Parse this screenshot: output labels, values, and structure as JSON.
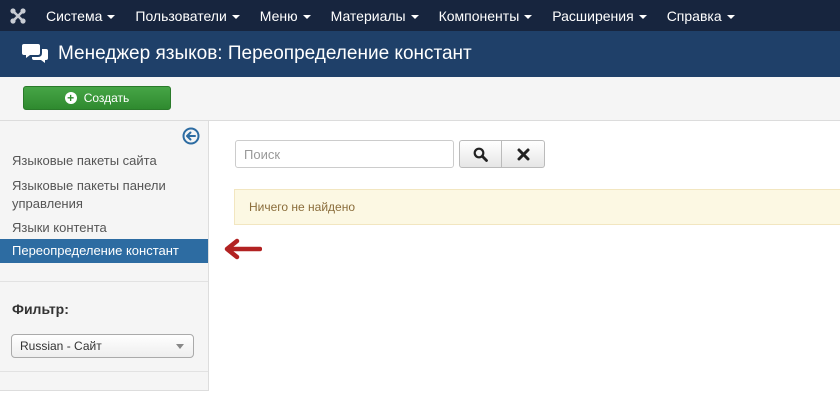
{
  "topnav": {
    "logo_icon": "joomla-logo-icon",
    "items": [
      {
        "label": "Система"
      },
      {
        "label": "Пользователи"
      },
      {
        "label": "Меню"
      },
      {
        "label": "Материалы"
      },
      {
        "label": "Компоненты"
      },
      {
        "label": "Расширения"
      },
      {
        "label": "Справка"
      }
    ]
  },
  "header": {
    "icon": "comments-icon",
    "title": "Менеджер языков: Переопределение констант"
  },
  "toolbar": {
    "create_label": "Создать"
  },
  "sidebar": {
    "items": [
      {
        "label": "Языковые пакеты сайта"
      },
      {
        "label": "Языковые пакеты панели управления"
      },
      {
        "label": "Языки контента"
      },
      {
        "label": "Переопределение констант",
        "active": true
      }
    ],
    "filter_label": "Фильтр:",
    "filter_value": "Russian - Сайт"
  },
  "main": {
    "search_placeholder": "Поиск",
    "search_value": "",
    "empty_message": "Ничего не найдено"
  },
  "colors": {
    "topnav_bg": "#17253e",
    "header_bg": "#1f4069",
    "create_button": "#3a963a",
    "active_item": "#2d6ca2",
    "alert_bg": "#fcf8e3",
    "arrow": "#b22222"
  }
}
